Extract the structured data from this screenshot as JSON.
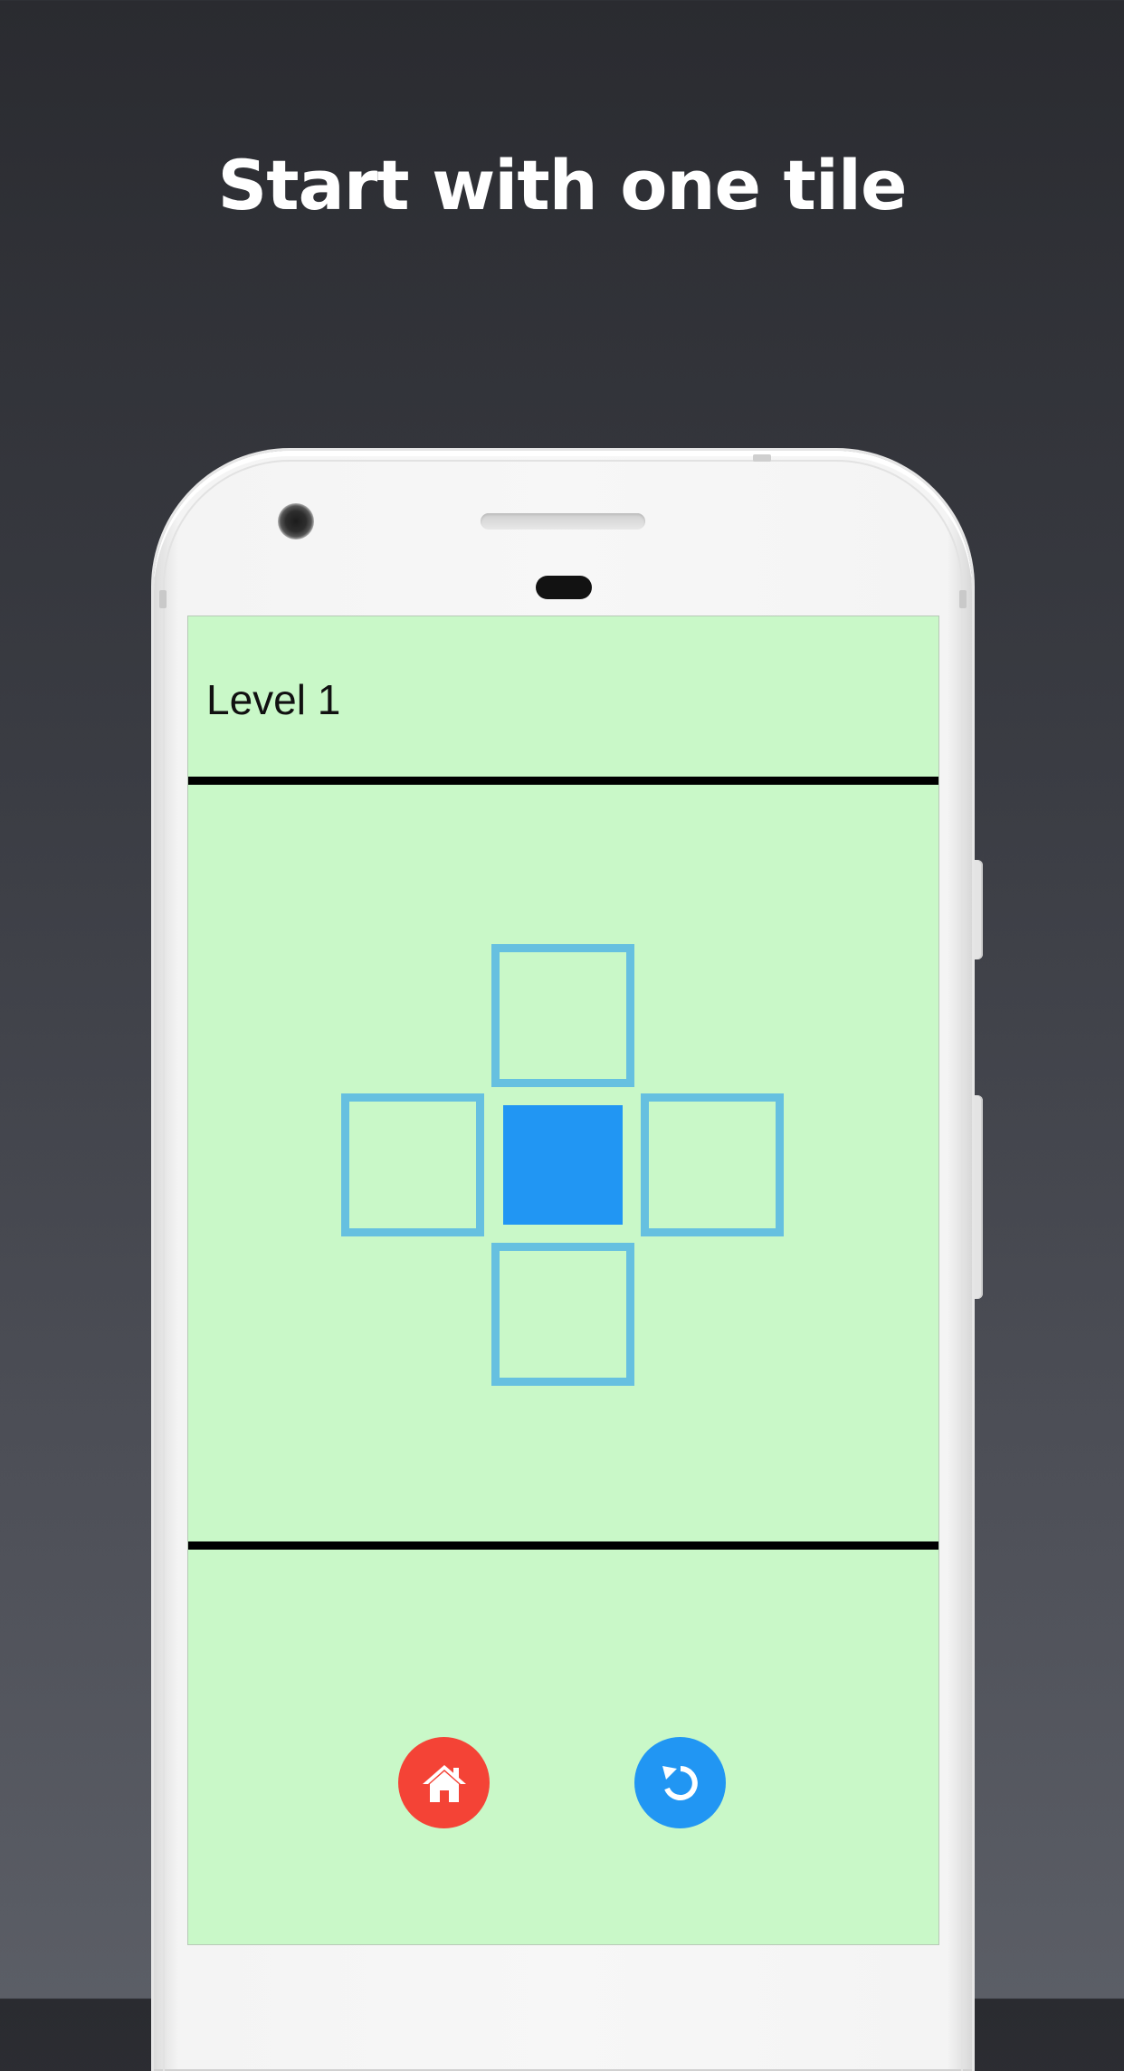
{
  "headline": "Start with one tile",
  "app": {
    "level_label": "Level 1",
    "colors": {
      "screen_background": "#c9f8c8",
      "divider": "#000000",
      "tile_outline": "#66c0e0",
      "tile_filled": "#2196f3",
      "home_button": "#f44336",
      "restart_button": "#2196f3"
    },
    "grid": {
      "tiles": [
        {
          "position": "up",
          "state": "empty"
        },
        {
          "position": "left",
          "state": "empty"
        },
        {
          "position": "center",
          "state": "filled"
        },
        {
          "position": "right",
          "state": "empty"
        },
        {
          "position": "down",
          "state": "empty"
        }
      ]
    },
    "buttons": {
      "home_icon": "home-icon",
      "restart_icon": "restart-icon"
    }
  }
}
